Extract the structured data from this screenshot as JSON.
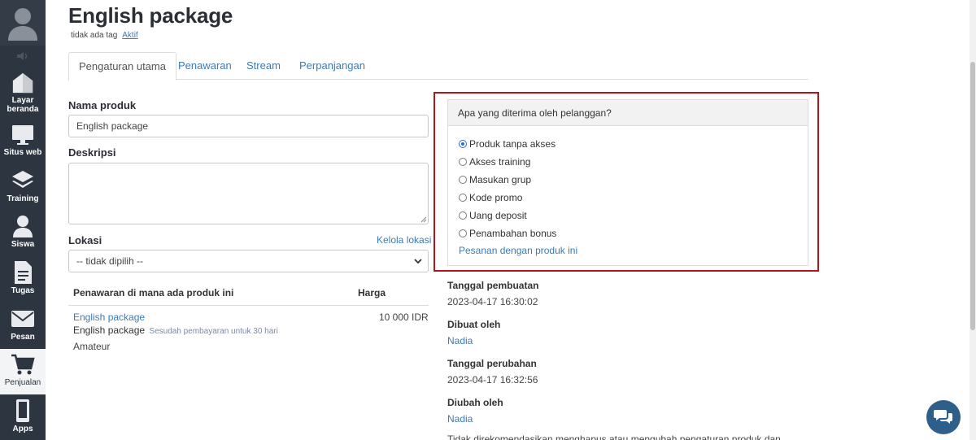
{
  "sidebar": {
    "items": [
      {
        "label": "Layar\nberanda",
        "icon": "home-icon"
      },
      {
        "label": "Situs web",
        "icon": "monitor-icon"
      },
      {
        "label": "Training",
        "icon": "layers-icon"
      },
      {
        "label": "Siswa",
        "icon": "user-icon"
      },
      {
        "label": "Tugas",
        "icon": "document-icon"
      },
      {
        "label": "Pesan",
        "icon": "mail-icon"
      },
      {
        "label": "Penjualan",
        "icon": "cart-icon"
      },
      {
        "label": "Apps",
        "icon": "phone-icon"
      }
    ]
  },
  "page": {
    "title": "English package",
    "tags": "tidak ada tag",
    "status": "Aktif"
  },
  "tabs": [
    "Pengaturan utama",
    "Penawaran",
    "Stream",
    "Perpanjangan"
  ],
  "form": {
    "name_label": "Nama produk",
    "name_value": "English package",
    "desc_label": "Deskripsi",
    "desc_value": "",
    "location_label": "Lokasi",
    "location_manage": "Kelola lokasi",
    "location_value": "-- tidak dipilih --"
  },
  "offers": {
    "col_offer": "Penawaran di mana ada produk ini",
    "col_price": "Harga",
    "rows": [
      {
        "link": "English package",
        "price": "10 000 IDR",
        "product": "English package",
        "note": "Sesudah pembayaran untuk 30 hari",
        "extra": "Amateur"
      }
    ]
  },
  "customer_panel": {
    "heading": "Apa yang diterima oleh pelanggan?",
    "options": [
      "Produk tanpa akses",
      "Akses training",
      "Masukan grup",
      "Kode promo",
      "Uang deposit",
      "Penambahan bonus"
    ],
    "selected": "Produk tanpa akses",
    "orders_link": "Pesanan dengan produk ini"
  },
  "meta": {
    "created_label": "Tanggal pembuatan",
    "created_value": "2023-04-17 16:30:02",
    "created_by_label": "Dibuat oleh",
    "created_by_value": "Nadia",
    "modified_label": "Tanggal perubahan",
    "modified_value": "2023-04-17 16:32:56",
    "modified_by_label": "Diubah oleh",
    "modified_by_value": "Nadia",
    "warning_partial": "Tidak direkomendasikan menghapus atau mengubah pengaturan produk dan"
  },
  "colors": {
    "sidebar": "#2d3640",
    "link": "#3d7bb5",
    "highlight": "#b0151c",
    "chat": "#2d5f8a"
  }
}
